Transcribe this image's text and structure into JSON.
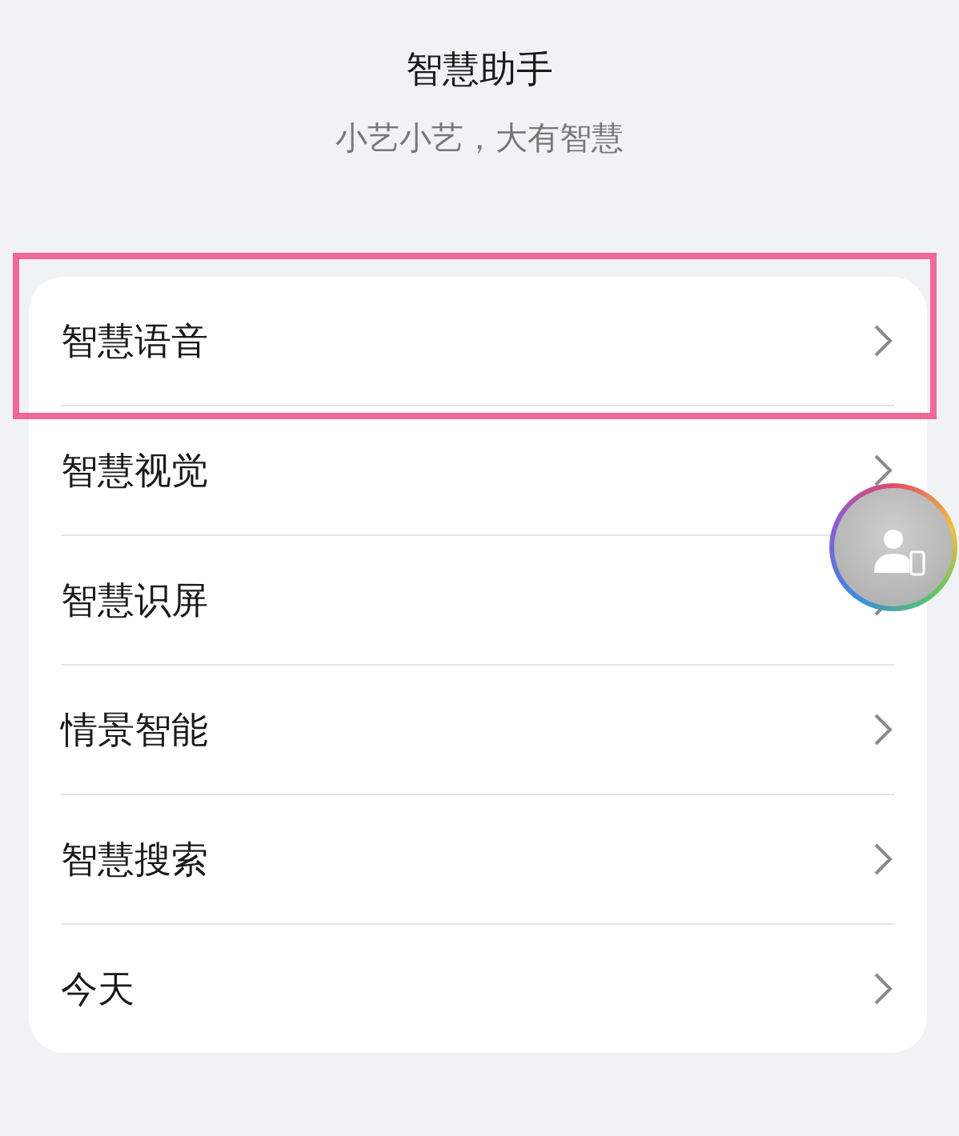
{
  "header": {
    "title": "智慧助手",
    "subtitle": "小艺小艺，大有智慧"
  },
  "items": [
    {
      "label": "智慧语音",
      "highlighted": true
    },
    {
      "label": "智慧视觉",
      "highlighted": false
    },
    {
      "label": "智慧识屏",
      "highlighted": false
    },
    {
      "label": "情景智能",
      "highlighted": false
    },
    {
      "label": "智慧搜索",
      "highlighted": false
    },
    {
      "label": "今天",
      "highlighted": false
    }
  ],
  "floating_button": {
    "kind": "assistant"
  }
}
